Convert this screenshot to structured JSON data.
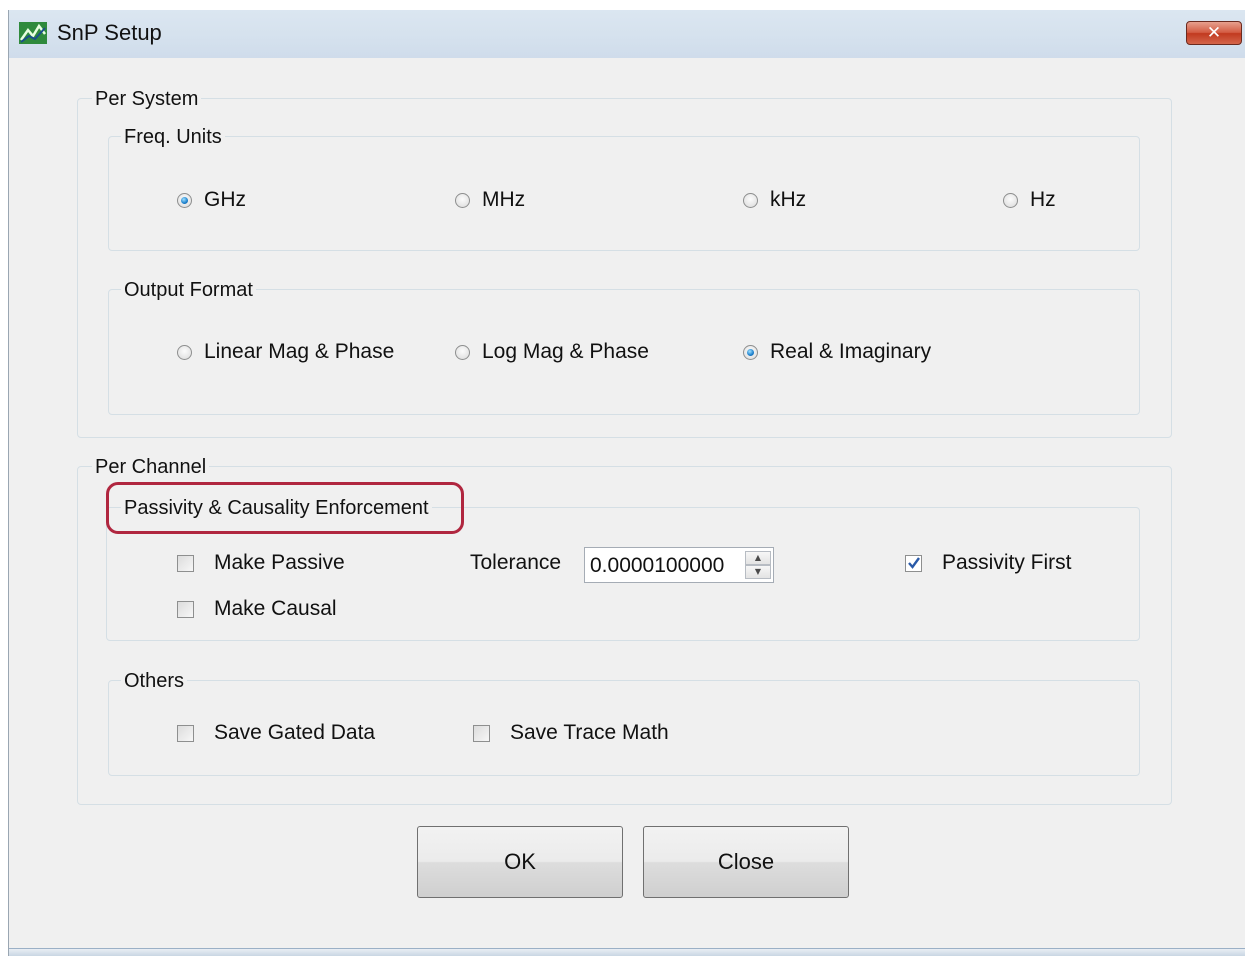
{
  "window": {
    "title": "SnP Setup",
    "close_label": "✕"
  },
  "per_system": {
    "label": "Per System",
    "freq_units": {
      "label": "Freq. Units",
      "options": [
        "GHz",
        "MHz",
        "kHz",
        "Hz"
      ],
      "selected": "GHz"
    },
    "output_format": {
      "label": "Output Format",
      "options": [
        "Linear Mag & Phase",
        "Log Mag & Phase",
        "Real & Imaginary"
      ],
      "selected": "Real & Imaginary"
    }
  },
  "per_channel": {
    "label": "Per Channel",
    "passivity": {
      "label": "Passivity & Causality Enforcement",
      "make_passive": {
        "label": "Make Passive",
        "checked": false
      },
      "make_causal": {
        "label": "Make Causal",
        "checked": false
      },
      "tolerance": {
        "label": "Tolerance",
        "value": "0.0000100000"
      },
      "passivity_first": {
        "label": "Passivity First",
        "checked": true
      }
    },
    "others": {
      "label": "Others",
      "save_gated_data": {
        "label": "Save Gated Data",
        "checked": false
      },
      "save_trace_math": {
        "label": "Save Trace Math",
        "checked": false
      }
    }
  },
  "buttons": {
    "ok": "OK",
    "close": "Close"
  },
  "colors": {
    "highlight": "#b0263f",
    "radio_selected": "#1b7fcc",
    "window_bg": "#f0f0f0"
  }
}
